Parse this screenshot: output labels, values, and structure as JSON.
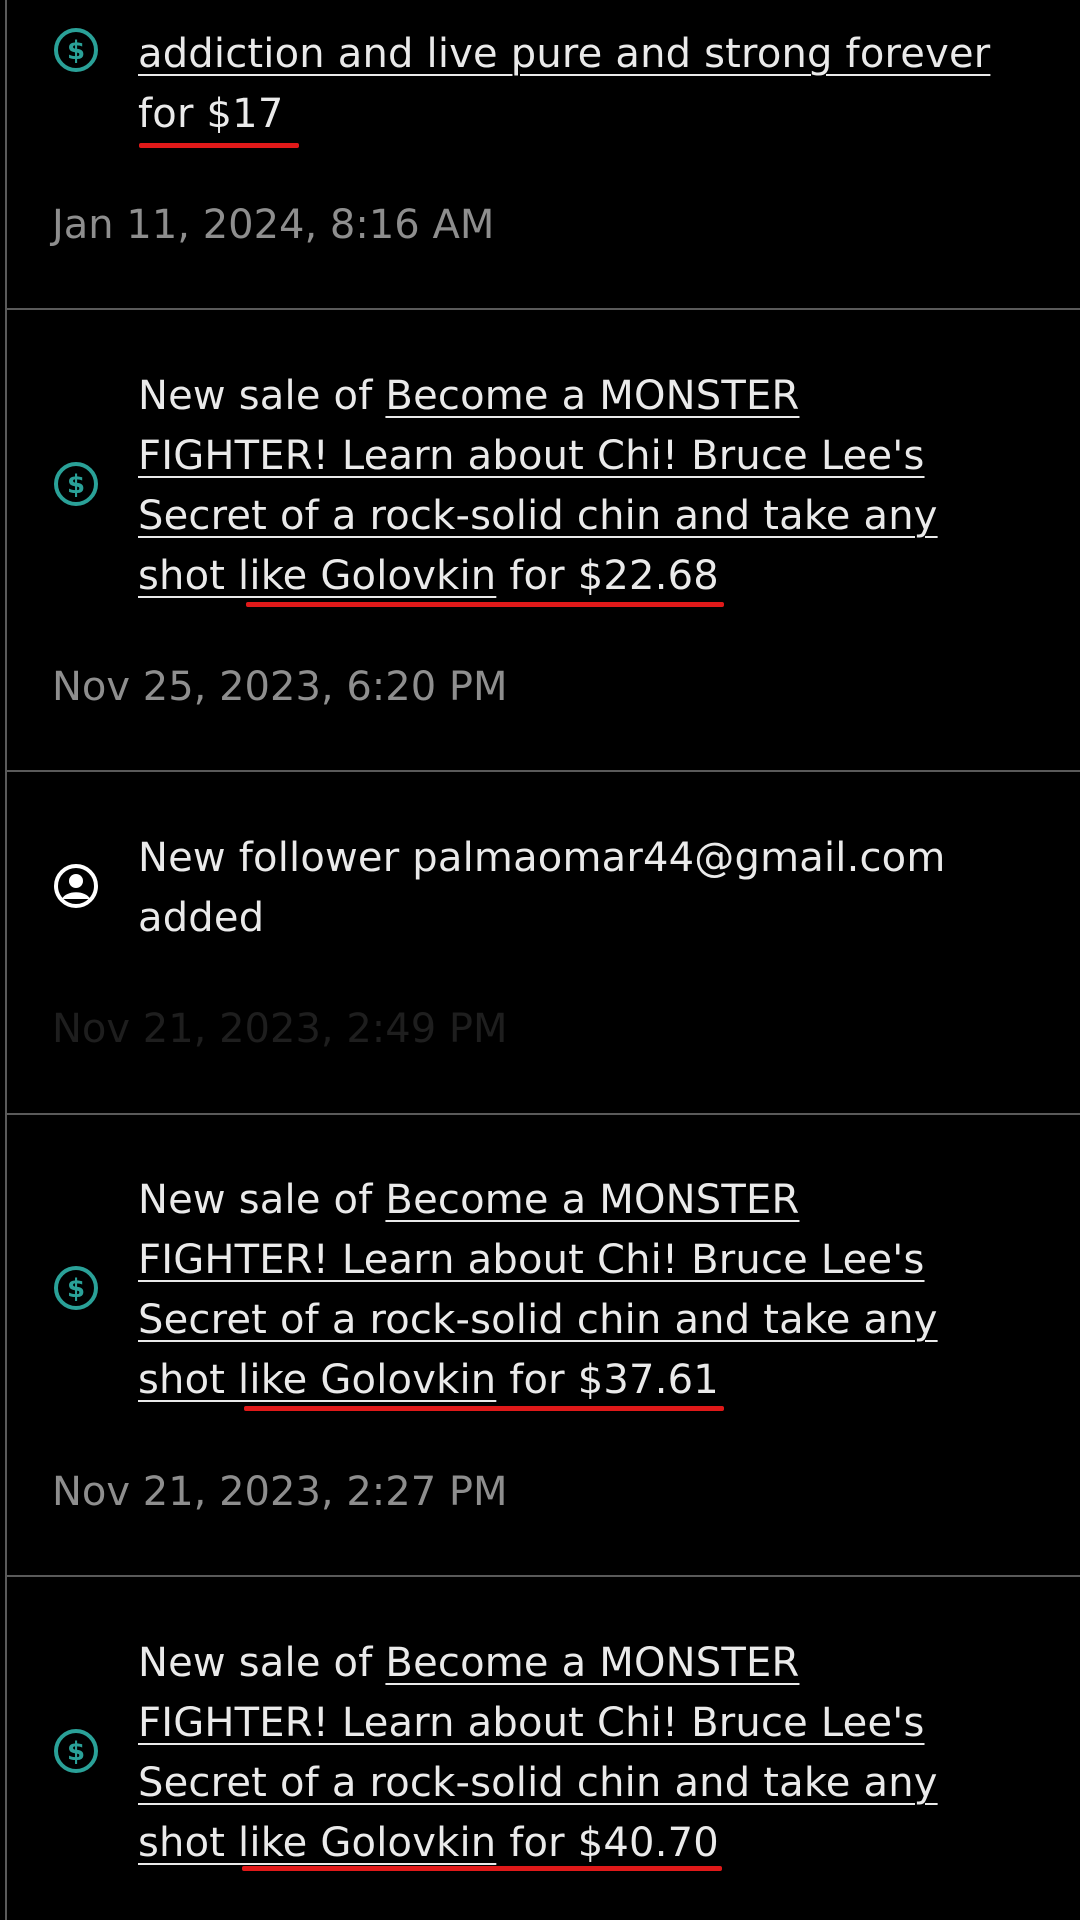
{
  "colors": {
    "background": "#000000",
    "text": "#eaeaea",
    "date_text": "#8e8e8e",
    "divider": "#5a5a5a",
    "sale_icon": "#2aa198",
    "follower_icon": "#ffffff",
    "annotation_underline": "#e01919"
  },
  "notifications": [
    {
      "icon": "dollar-circle-icon",
      "product_tail_line1": "addiction and live pure and strong forever",
      "product_tail_line2": "for $17",
      "date": "Jan 11, 2024, 8:16 AM"
    },
    {
      "icon": "dollar-circle-icon",
      "prefix": "New sale of ",
      "product": "Become a MONSTER FIGHTER! Learn about Chi! Bruce Lee's Secret of a rock-solid chin and take any shot like Golovkin",
      "suffix": " for $22.68",
      "date": "Nov 25, 2023, 6:20 PM"
    },
    {
      "icon": "user-circle-icon",
      "text": "New follower palmaomar44@gmail.com added",
      "date": "Nov 21, 2023, 2:49 PM"
    },
    {
      "icon": "dollar-circle-icon",
      "prefix": "New sale of ",
      "product": "Become a MONSTER FIGHTER! Learn about Chi! Bruce Lee's Secret of a rock-solid chin and take any shot like Golovkin",
      "suffix": " for $37.61",
      "date": "Nov 21, 2023, 2:27 PM"
    },
    {
      "icon": "dollar-circle-icon",
      "prefix": "New sale of ",
      "product": "Become a MONSTER FIGHTER! Learn about Chi! Bruce Lee's Secret of a rock-solid chin and take any shot like Golovkin",
      "suffix": " for $40.70"
    }
  ]
}
